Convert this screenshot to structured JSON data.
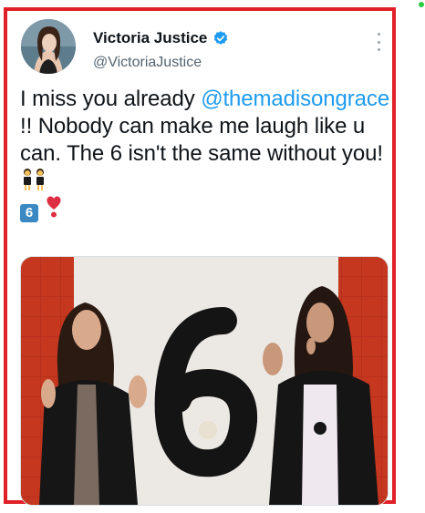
{
  "tweet": {
    "author_name": "Victoria Justice",
    "author_handle": "@VictoriaJustice",
    "verified": true,
    "text_before_mention": "I miss you already ",
    "mention": "@themadisongrace",
    "text_after_mention": " !! Nobody can make me laugh like u can. The 6 isn't the same without you! ",
    "keycap_label": "6"
  },
  "icons": {
    "verified": "verified-badge-icon",
    "more": "more-options-icon",
    "twins": "dancing-twins-emoji-icon",
    "heart": "heart-exclamation-emoji-icon"
  },
  "colors": {
    "frame": "#e02027",
    "accent": "#1d9bf0",
    "keycap": "#3b88c3"
  }
}
